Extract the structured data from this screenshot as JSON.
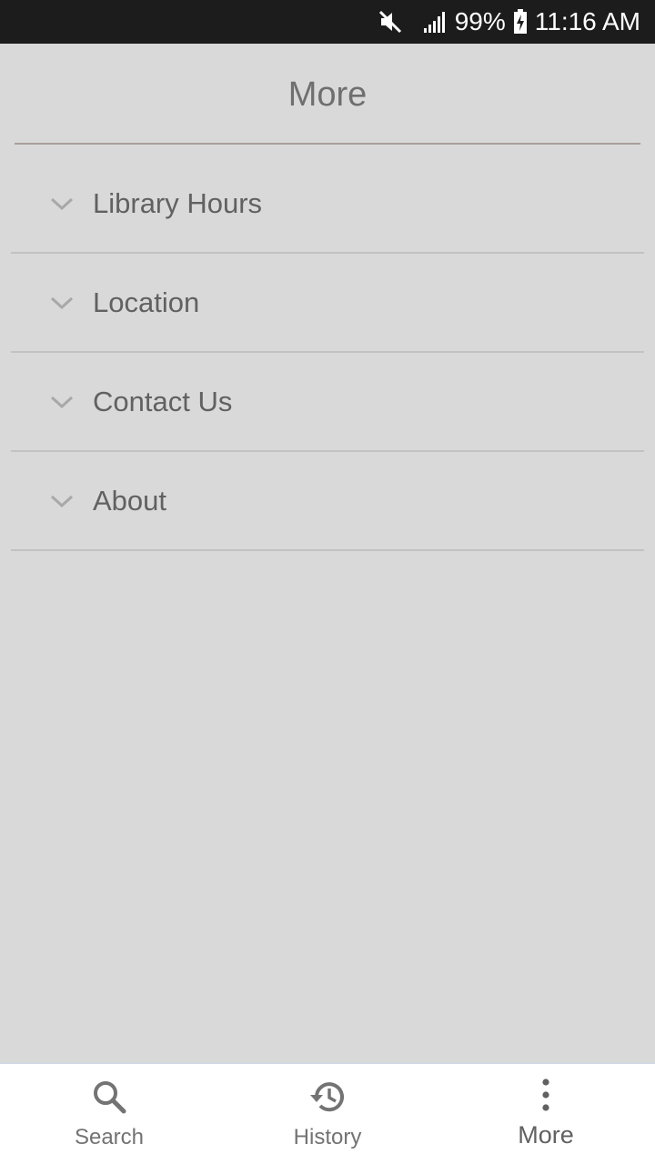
{
  "status_bar": {
    "battery": "99%",
    "time": "11:16 AM",
    "icons": [
      "mute-icon",
      "signal-icon",
      "battery-charging-icon"
    ]
  },
  "header": {
    "title": "More"
  },
  "menu": {
    "items": [
      {
        "label": "Library Hours",
        "icon": "chevron-down-icon"
      },
      {
        "label": "Location",
        "icon": "chevron-down-icon"
      },
      {
        "label": "Contact Us",
        "icon": "chevron-down-icon"
      },
      {
        "label": "About",
        "icon": "chevron-down-icon"
      }
    ]
  },
  "bottom_nav": {
    "items": [
      {
        "label": "Search",
        "icon": "search-icon",
        "active": false
      },
      {
        "label": "History",
        "icon": "history-icon",
        "active": false
      },
      {
        "label": "More",
        "icon": "more-vertical-icon",
        "active": true
      }
    ]
  },
  "colors": {
    "background": "#d9d9d9",
    "status_bar": "#1c1c1c",
    "text": "#616161",
    "divider": "#c2c2c2"
  }
}
